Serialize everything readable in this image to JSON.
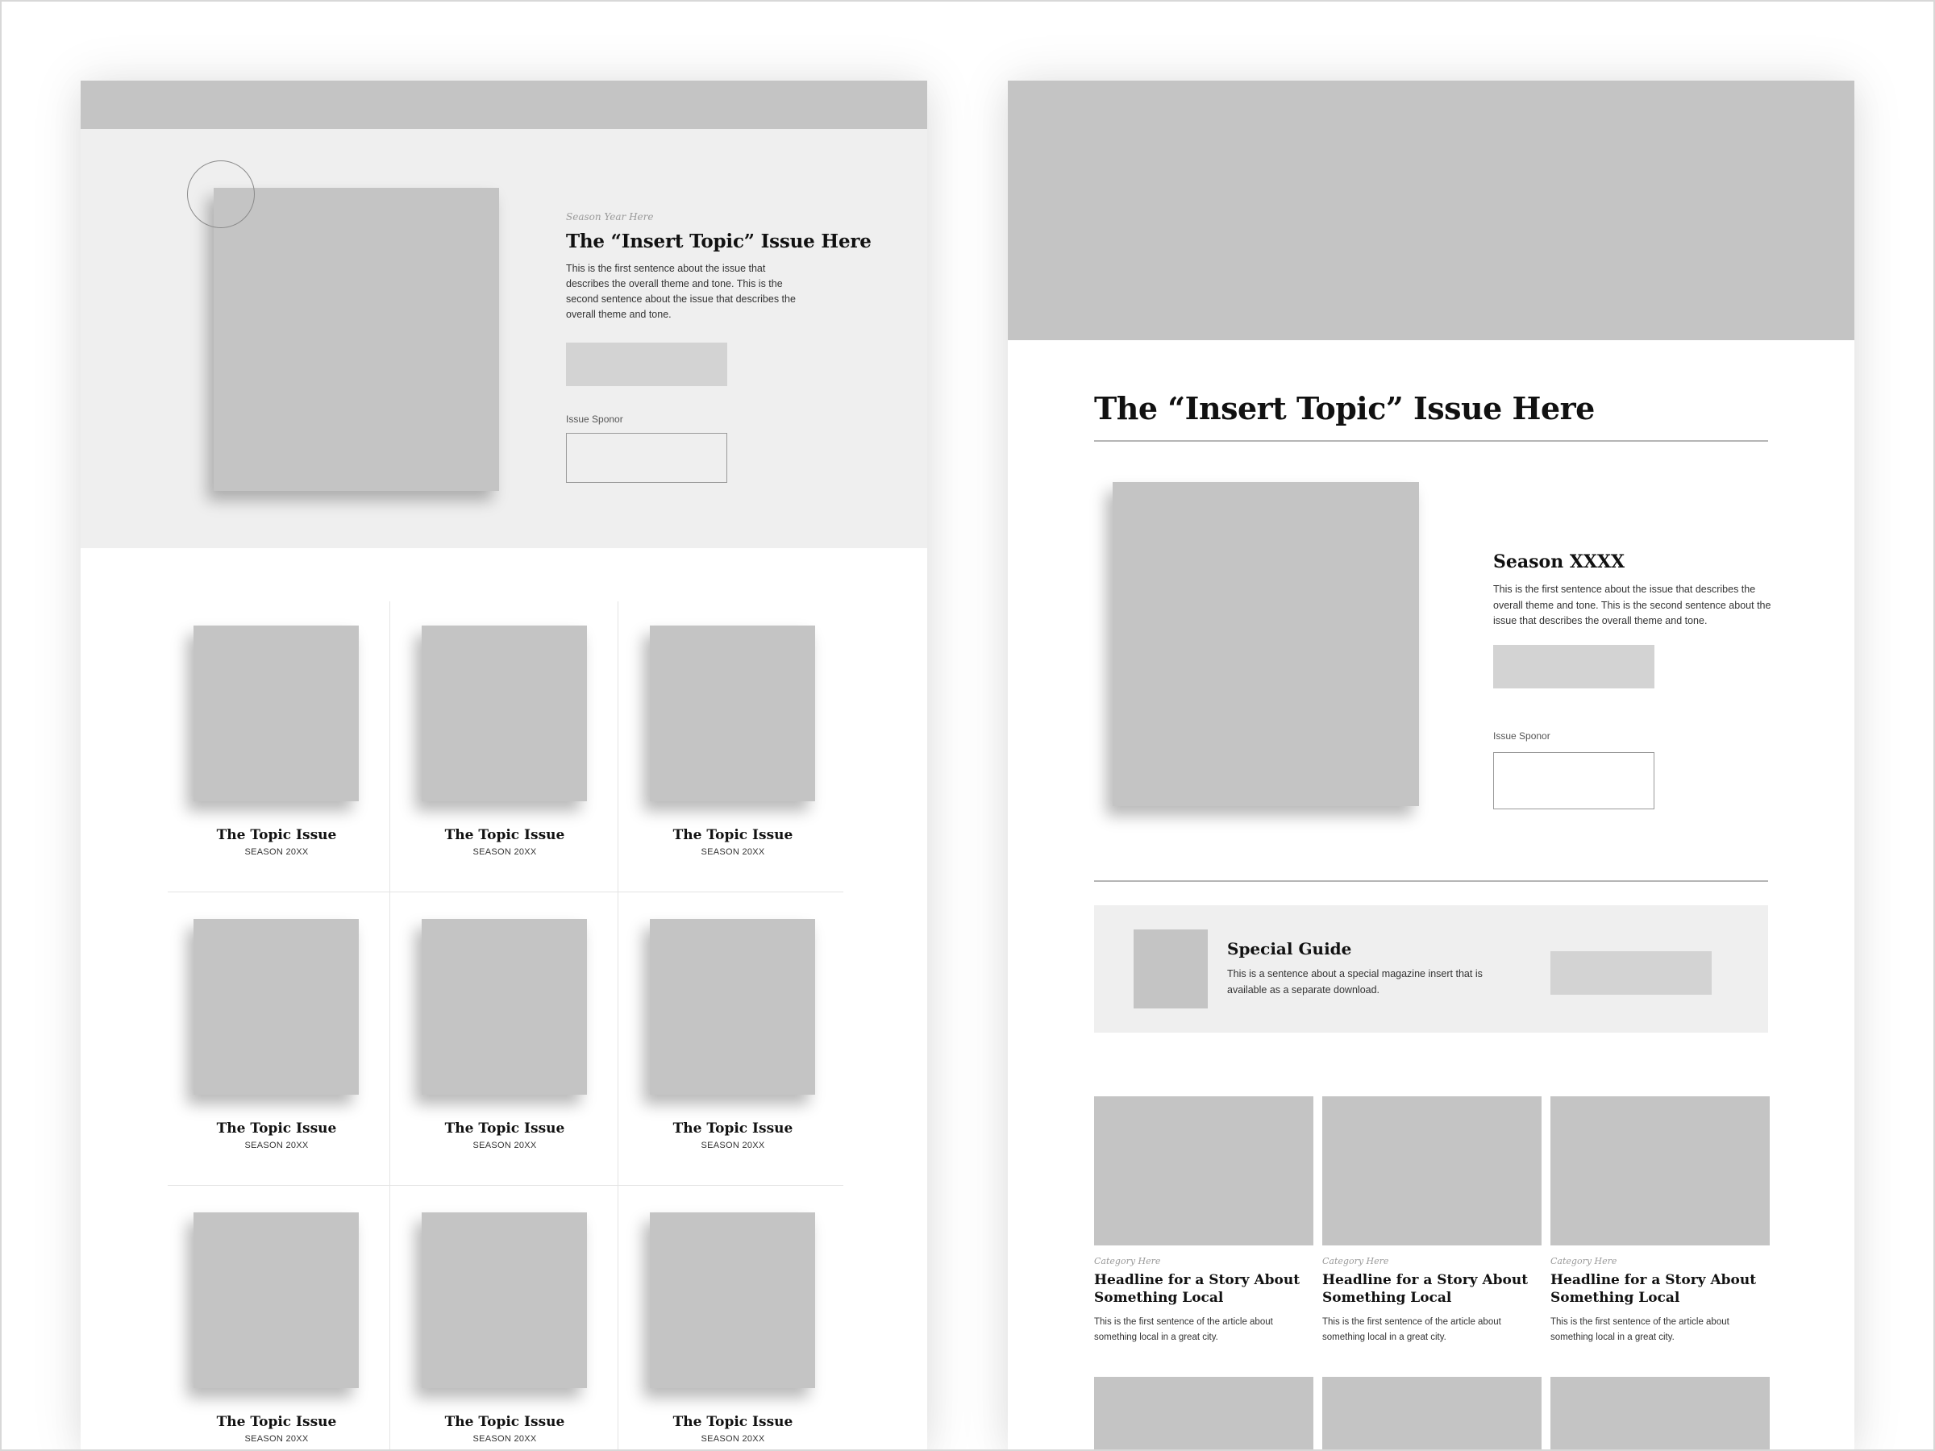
{
  "left_page": {
    "hero": {
      "season_label": "Season Year Here",
      "title": "The “Insert Topic” Issue Here",
      "description": "This is the first sentence about the issue that describes the overall theme and tone. This is the second sentence about the issue that describes the overall theme and tone.",
      "sponsor_label": "Issue Sponor"
    },
    "issues": [
      {
        "title": "The Topic Issue",
        "season": "SEASON 20XX"
      },
      {
        "title": "The Topic Issue",
        "season": "SEASON 20XX"
      },
      {
        "title": "The Topic Issue",
        "season": "SEASON 20XX"
      },
      {
        "title": "The Topic Issue",
        "season": "SEASON 20XX"
      },
      {
        "title": "The Topic Issue",
        "season": "SEASON 20XX"
      },
      {
        "title": "The Topic Issue",
        "season": "SEASON 20XX"
      },
      {
        "title": "The Topic Issue",
        "season": "SEASON 20XX"
      },
      {
        "title": "The Topic Issue",
        "season": "SEASON 20XX"
      },
      {
        "title": "The Topic Issue",
        "season": "SEASON 20XX"
      }
    ]
  },
  "right_page": {
    "title": "The “Insert Topic” Issue Here",
    "season": "Season XXXX",
    "description": "This is the first sentence about the issue that describes the overall theme and tone. This is the second sentence about the issue that describes the overall theme and tone.",
    "sponsor_label": "Issue Sponor",
    "special_guide": {
      "title": "Special Guide",
      "description": "This is a sentence about a special magazine insert that is available as a separate download."
    },
    "stories": [
      {
        "category": "Category Here",
        "headline": "Headline for a Story About Something Local",
        "description": "This is the first sentence of the article about something local in a great city."
      },
      {
        "category": "Category Here",
        "headline": "Headline for a Story About Something Local",
        "description": "This is the first sentence of the article about something local in a great city."
      },
      {
        "category": "Category Here",
        "headline": "Headline for a Story About Something Local",
        "description": "This is the first sentence of the article about something local in a great city."
      }
    ]
  },
  "colors": {
    "placeholder": "#c4c4c4",
    "placeholder_light": "#d3d3d3",
    "section_bg": "#efefef",
    "rule": "#b5b5b5"
  }
}
